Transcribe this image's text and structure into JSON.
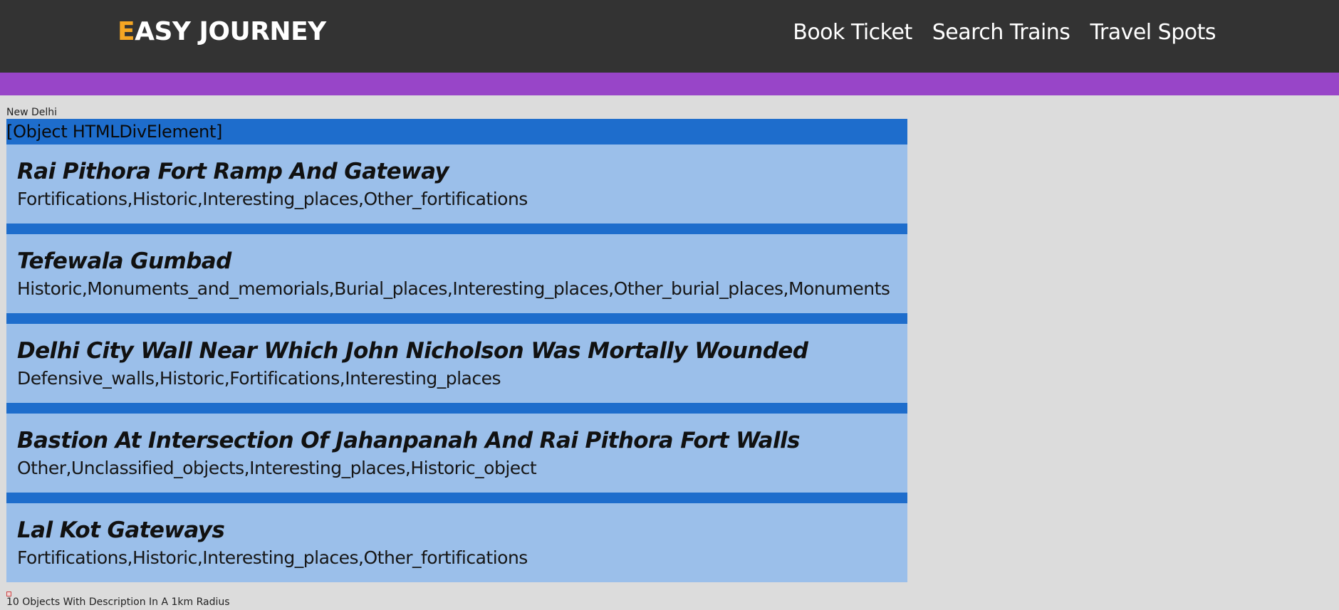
{
  "header": {
    "brand_first_letter": "E",
    "brand_rest": "ASY JOURNEY",
    "nav": [
      "Book Ticket",
      "Search Trains",
      "Travel Spots"
    ],
    "colors": {
      "background": "#333333",
      "brand_accent": "#f5a623",
      "accent_bar": "#9845c8"
    }
  },
  "main": {
    "city": "New Delhi",
    "results_header": "[Object HTMLDivElement]",
    "places": [
      {
        "name": "Rai Pithora Fort Ramp And Gateway",
        "kinds": "Fortifications,Historic,Interesting_places,Other_fortifications"
      },
      {
        "name": "Tefewala Gumbad",
        "kinds": "Historic,Monuments_and_memorials,Burial_places,Interesting_places,Other_burial_places,Monuments"
      },
      {
        "name": "Delhi City Wall Near Which John Nicholson Was Mortally Wounded",
        "kinds": "Defensive_walls,Historic,Fortifications,Interesting_places"
      },
      {
        "name": "Bastion At Intersection Of Jahanpanah And Rai Pithora Fort Walls",
        "kinds": "Other,Unclassified_objects,Interesting_places,Historic_object"
      },
      {
        "name": "Lal Kot Gateways",
        "kinds": "Fortifications,Historic,Interesting_places,Other_fortifications"
      }
    ],
    "footnote": "10 Objects With Description In A 1km Radius",
    "colors": {
      "results_bg": "#1e6dcc",
      "card_bg": "#9bbfea"
    }
  }
}
